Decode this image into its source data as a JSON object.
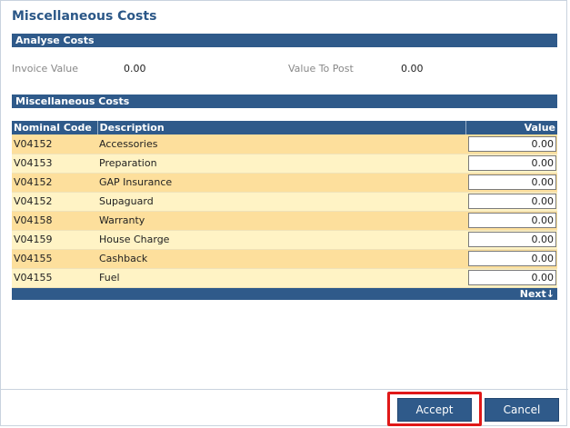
{
  "dialog": {
    "title": "Miscellaneous Costs"
  },
  "analyse": {
    "header": "Analyse Costs",
    "invoice_value_label": "Invoice Value",
    "invoice_value": "0.00",
    "value_to_post_label": "Value To Post",
    "value_to_post": "0.00"
  },
  "misc": {
    "header": "Miscellaneous Costs",
    "columns": {
      "code": "Nominal Code",
      "description": "Description",
      "value": "Value"
    },
    "rows": [
      {
        "code": "V04152",
        "description": "Accessories",
        "value": "0.00"
      },
      {
        "code": "V04153",
        "description": "Preparation",
        "value": "0.00"
      },
      {
        "code": "V04152",
        "description": "GAP Insurance",
        "value": "0.00"
      },
      {
        "code": "V04152",
        "description": "Supaguard",
        "value": "0.00"
      },
      {
        "code": "V04158",
        "description": "Warranty",
        "value": "0.00"
      },
      {
        "code": "V04159",
        "description": "House Charge",
        "value": "0.00"
      },
      {
        "code": "V04155",
        "description": "Cashback",
        "value": "0.00"
      },
      {
        "code": "V04155",
        "description": "Fuel",
        "value": "0.00"
      }
    ],
    "next_label": "Next"
  },
  "buttons": {
    "accept": "Accept",
    "cancel": "Cancel"
  },
  "colors": {
    "header_blue": "#2f5a8a",
    "row_odd": "#fddf9c",
    "row_even": "#fff3c5",
    "highlight": "#e01818"
  }
}
